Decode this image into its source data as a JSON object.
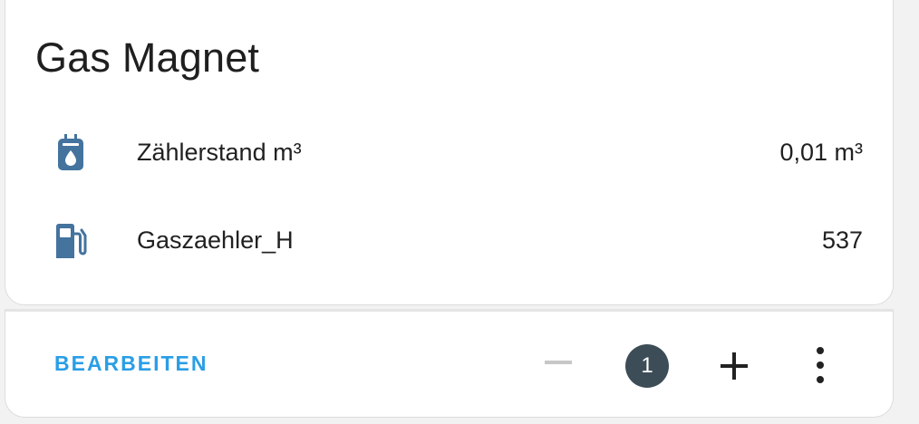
{
  "card": {
    "title": "Gas Magnet",
    "entities": [
      {
        "icon": "meter-gas-icon",
        "name": "Zählerstand m³",
        "state": "0,01 m³"
      },
      {
        "icon": "gas-station-icon",
        "name": "Gaszaehler_H",
        "state": "537"
      }
    ]
  },
  "footer": {
    "edit_label": "BEARBEITEN",
    "count": "1"
  },
  "colors": {
    "icon": "#44739e",
    "accent": "#2a9ee6",
    "badge": "#3c4d57"
  }
}
